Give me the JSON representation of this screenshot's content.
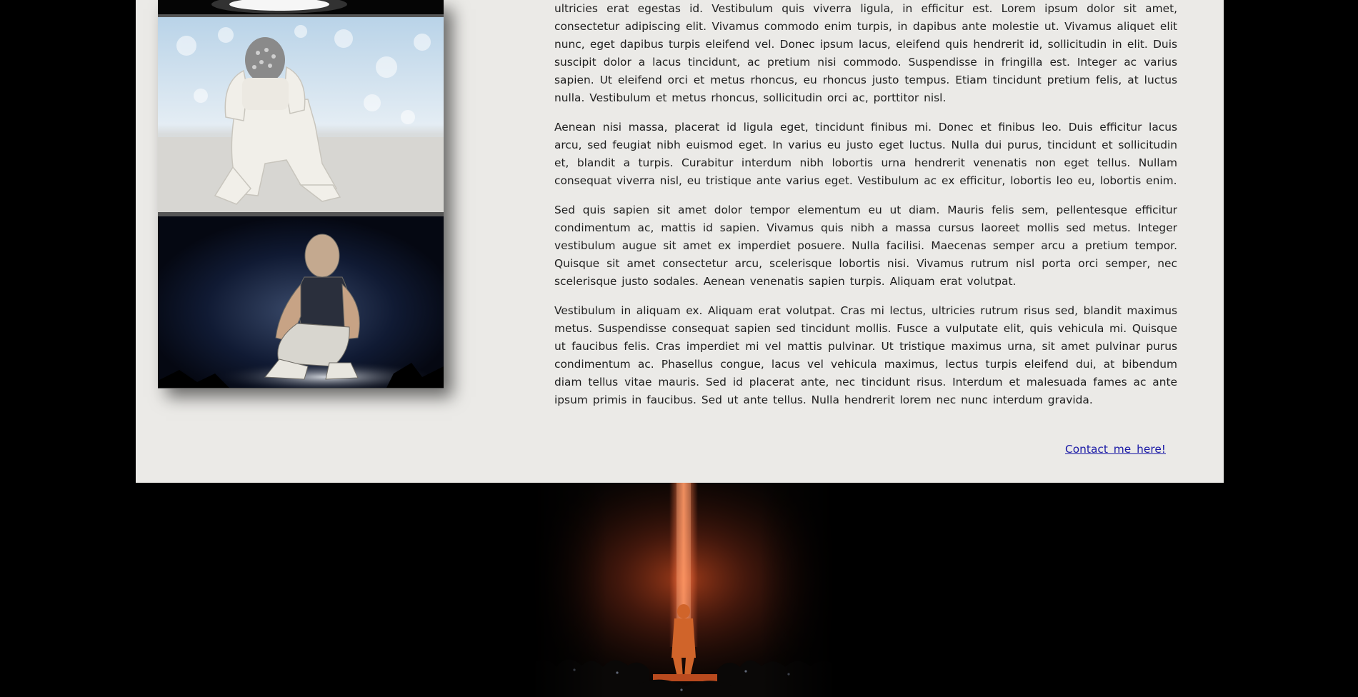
{
  "photos": [
    {
      "name": "concert-photo-stage-light",
      "alt": ""
    },
    {
      "name": "concert-photo-kneeling-performer",
      "alt": ""
    },
    {
      "name": "concert-photo-crouching-performer",
      "alt": ""
    }
  ],
  "article": {
    "paragraphs": [
      "ultricies erat egestas id. Vestibulum quis viverra ligula, in efficitur est. Lorem ipsum dolor sit amet, consectetur adipiscing elit. Vivamus commodo enim turpis, in dapibus ante molestie ut. Vivamus aliquet elit nunc, eget dapibus turpis eleifend vel. Donec ipsum lacus, eleifend quis hendrerit id, sollicitudin in elit. Duis suscipit dolor a lacus tincidunt, ac pretium nisi commodo. Suspendisse in fringilla est. Integer ac varius sapien. Ut eleifend orci et metus rhoncus, eu rhoncus justo tempus. Etiam tincidunt pretium felis, at luctus nulla. Vestibulum et metus rhoncus, sollicitudin orci ac, porttitor nisl.",
      "Aenean nisi massa, placerat id ligula eget, tincidunt finibus mi. Donec et finibus leo. Duis efficitur lacus arcu, sed feugiat nibh euismod eget. In varius eu justo eget luctus. Nulla dui purus, tincidunt et sollicitudin et, blandit a turpis. Curabitur interdum nibh lobortis urna hendrerit venenatis non eget tellus. Nullam consequat viverra nisl, eu tristique ante varius eget. Vestibulum ac ex efficitur, lobortis leo eu, lobortis enim.",
      "Sed quis sapien sit amet dolor tempor elementum eu ut diam. Mauris felis sem, pellentesque efficitur condimentum ac, mattis id sapien. Vivamus quis nibh a massa cursus laoreet mollis sed metus. Integer vestibulum augue sit amet ex imperdiet posuere. Nulla facilisi. Maecenas semper arcu a pretium tempor. Quisque sit amet consectetur arcu, scelerisque lobortis nisi. Vivamus rutrum nisl porta orci semper, nec scelerisque justo sodales. Aenean venenatis sapien turpis. Aliquam erat volutpat.",
      "Vestibulum in aliquam ex. Aliquam erat volutpat. Cras mi lectus, ultricies rutrum risus sed, blandit maximus metus. Suspendisse consequat sapien sed tincidunt mollis. Fusce a vulputate elit, quis vehicula mi. Quisque ut faucibus felis. Cras imperdiet mi vel mattis pulvinar. Ut tristique maximus urna, sit amet pulvinar purus condimentum ac. Phasellus congue, lacus vel vehicula maximus, lectus turpis eleifend dui, at bibendum diam tellus vitae mauris. Sed id placerat ante, nec tincidunt risus. Interdum et malesuada fames ac ante ipsum primis in faucibus. Sed ut ante tellus. Nulla hendrerit lorem nec nunc interdum gravida."
    ]
  },
  "contact": {
    "label": "Contact me here!"
  },
  "colors": {
    "page_background": "#000000",
    "panel_background": "#ebeae7",
    "body_text": "#1e1e1e",
    "link": "#1a1aa6",
    "stage_glow": "#c24a22"
  }
}
